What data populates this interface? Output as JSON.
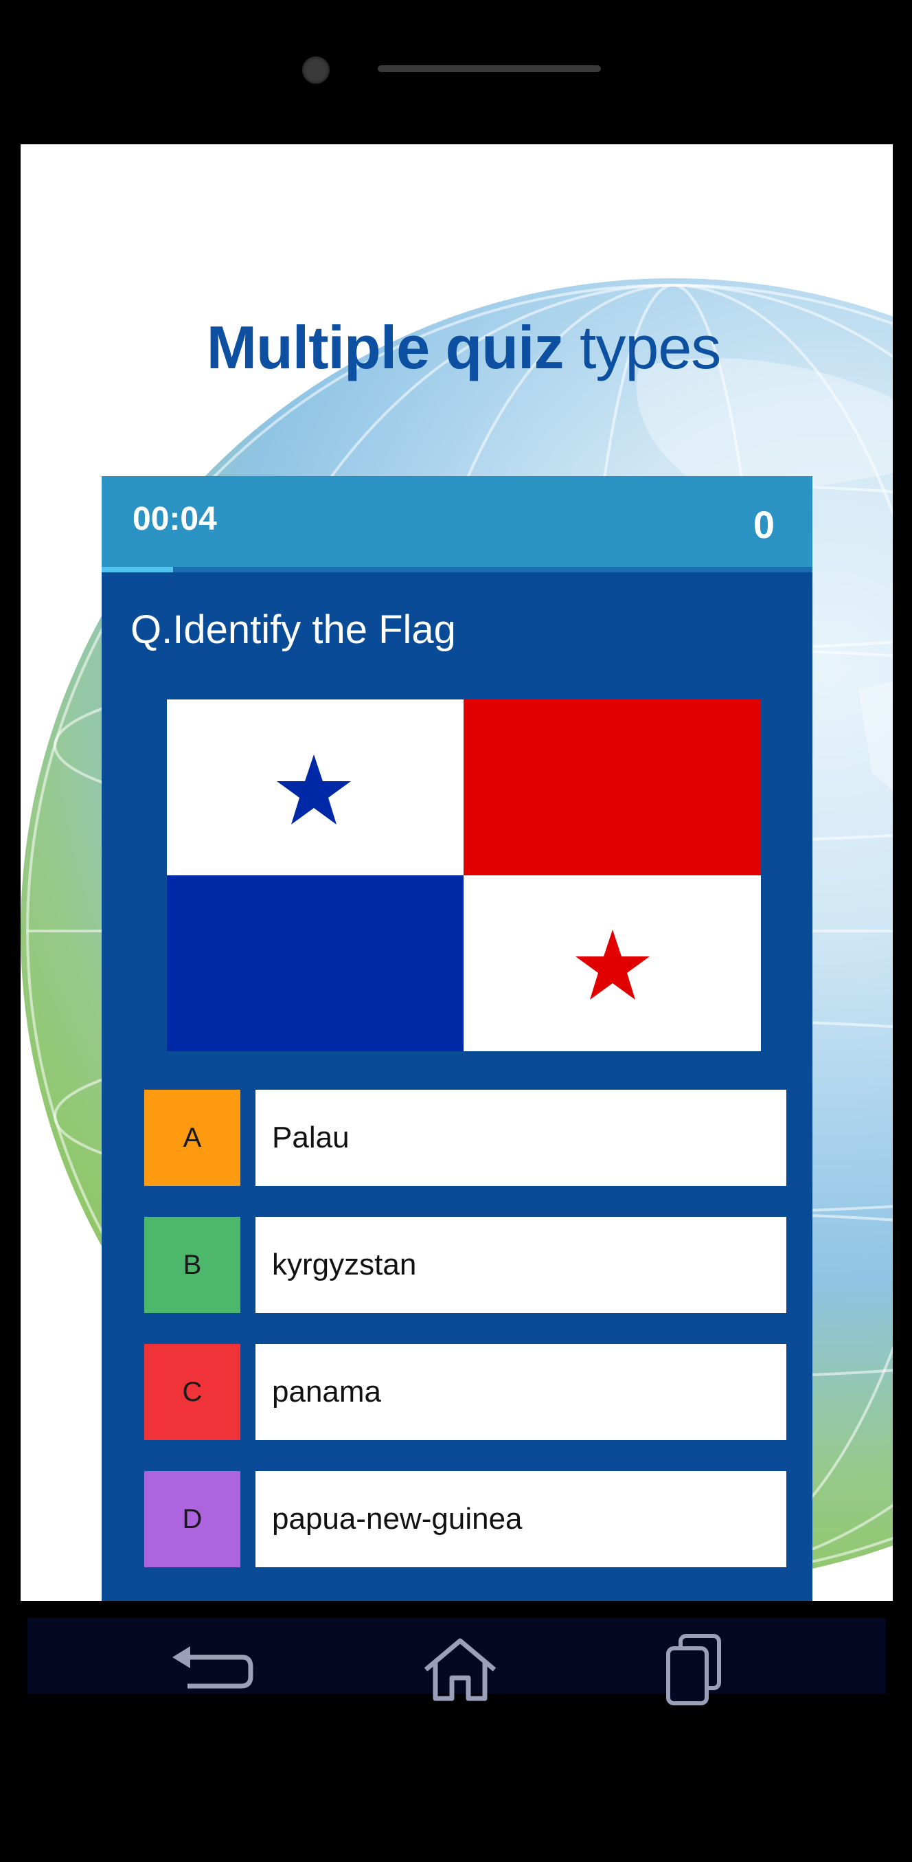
{
  "promo": {
    "headline_bold": "Multiple quiz",
    "headline_light": "types"
  },
  "quiz": {
    "timer": "00:04",
    "score": "0",
    "progress": 0.1,
    "question": "Q.Identify the Flag",
    "flag_icon": "flag-of-panama",
    "options": [
      {
        "letter": "A",
        "text": "Palau",
        "color": "#fd9a0f"
      },
      {
        "letter": "B",
        "text": "kyrgyzstan",
        "color": "#4db86b"
      },
      {
        "letter": "C",
        "text": "panama",
        "color": "#ef3338"
      },
      {
        "letter": "D",
        "text": "papua-new-guinea",
        "color": "#ad64df"
      }
    ]
  },
  "colors": {
    "header": "#2b93c3",
    "card": "#0a4b97",
    "headline": "#0d4fa0"
  },
  "navbar": {
    "icons": [
      "back-icon",
      "home-icon",
      "recent-apps-icon"
    ]
  }
}
